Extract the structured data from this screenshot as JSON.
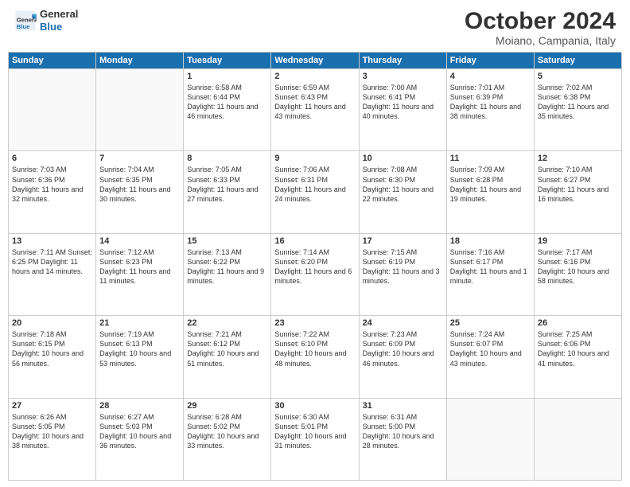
{
  "header": {
    "logo_line1": "General",
    "logo_line2": "Blue",
    "month": "October 2024",
    "location": "Moiano, Campania, Italy"
  },
  "days_of_week": [
    "Sunday",
    "Monday",
    "Tuesday",
    "Wednesday",
    "Thursday",
    "Friday",
    "Saturday"
  ],
  "weeks": [
    [
      {
        "day": "",
        "info": ""
      },
      {
        "day": "",
        "info": ""
      },
      {
        "day": "1",
        "info": "Sunrise: 6:58 AM\nSunset: 6:44 PM\nDaylight: 11 hours and 46 minutes."
      },
      {
        "day": "2",
        "info": "Sunrise: 6:59 AM\nSunset: 6:43 PM\nDaylight: 11 hours and 43 minutes."
      },
      {
        "day": "3",
        "info": "Sunrise: 7:00 AM\nSunset: 6:41 PM\nDaylight: 11 hours and 40 minutes."
      },
      {
        "day": "4",
        "info": "Sunrise: 7:01 AM\nSunset: 6:39 PM\nDaylight: 11 hours and 38 minutes."
      },
      {
        "day": "5",
        "info": "Sunrise: 7:02 AM\nSunset: 6:38 PM\nDaylight: 11 hours and 35 minutes."
      }
    ],
    [
      {
        "day": "6",
        "info": "Sunrise: 7:03 AM\nSunset: 6:36 PM\nDaylight: 11 hours and 32 minutes."
      },
      {
        "day": "7",
        "info": "Sunrise: 7:04 AM\nSunset: 6:35 PM\nDaylight: 11 hours and 30 minutes."
      },
      {
        "day": "8",
        "info": "Sunrise: 7:05 AM\nSunset: 6:33 PM\nDaylight: 11 hours and 27 minutes."
      },
      {
        "day": "9",
        "info": "Sunrise: 7:06 AM\nSunset: 6:31 PM\nDaylight: 11 hours and 24 minutes."
      },
      {
        "day": "10",
        "info": "Sunrise: 7:08 AM\nSunset: 6:30 PM\nDaylight: 11 hours and 22 minutes."
      },
      {
        "day": "11",
        "info": "Sunrise: 7:09 AM\nSunset: 6:28 PM\nDaylight: 11 hours and 19 minutes."
      },
      {
        "day": "12",
        "info": "Sunrise: 7:10 AM\nSunset: 6:27 PM\nDaylight: 11 hours and 16 minutes."
      }
    ],
    [
      {
        "day": "13",
        "info": "Sunrise: 7:11 AM\nSunset: 6:25 PM\nDaylight: 11 hours and 14 minutes."
      },
      {
        "day": "14",
        "info": "Sunrise: 7:12 AM\nSunset: 6:23 PM\nDaylight: 11 hours and 11 minutes."
      },
      {
        "day": "15",
        "info": "Sunrise: 7:13 AM\nSunset: 6:22 PM\nDaylight: 11 hours and 9 minutes."
      },
      {
        "day": "16",
        "info": "Sunrise: 7:14 AM\nSunset: 6:20 PM\nDaylight: 11 hours and 6 minutes."
      },
      {
        "day": "17",
        "info": "Sunrise: 7:15 AM\nSunset: 6:19 PM\nDaylight: 11 hours and 3 minutes."
      },
      {
        "day": "18",
        "info": "Sunrise: 7:16 AM\nSunset: 6:17 PM\nDaylight: 11 hours and 1 minute."
      },
      {
        "day": "19",
        "info": "Sunrise: 7:17 AM\nSunset: 6:16 PM\nDaylight: 10 hours and 58 minutes."
      }
    ],
    [
      {
        "day": "20",
        "info": "Sunrise: 7:18 AM\nSunset: 6:15 PM\nDaylight: 10 hours and 56 minutes."
      },
      {
        "day": "21",
        "info": "Sunrise: 7:19 AM\nSunset: 6:13 PM\nDaylight: 10 hours and 53 minutes."
      },
      {
        "day": "22",
        "info": "Sunrise: 7:21 AM\nSunset: 6:12 PM\nDaylight: 10 hours and 51 minutes."
      },
      {
        "day": "23",
        "info": "Sunrise: 7:22 AM\nSunset: 6:10 PM\nDaylight: 10 hours and 48 minutes."
      },
      {
        "day": "24",
        "info": "Sunrise: 7:23 AM\nSunset: 6:09 PM\nDaylight: 10 hours and 46 minutes."
      },
      {
        "day": "25",
        "info": "Sunrise: 7:24 AM\nSunset: 6:07 PM\nDaylight: 10 hours and 43 minutes."
      },
      {
        "day": "26",
        "info": "Sunrise: 7:25 AM\nSunset: 6:06 PM\nDaylight: 10 hours and 41 minutes."
      }
    ],
    [
      {
        "day": "27",
        "info": "Sunrise: 6:26 AM\nSunset: 5:05 PM\nDaylight: 10 hours and 38 minutes."
      },
      {
        "day": "28",
        "info": "Sunrise: 6:27 AM\nSunset: 5:03 PM\nDaylight: 10 hours and 36 minutes."
      },
      {
        "day": "29",
        "info": "Sunrise: 6:28 AM\nSunset: 5:02 PM\nDaylight: 10 hours and 33 minutes."
      },
      {
        "day": "30",
        "info": "Sunrise: 6:30 AM\nSunset: 5:01 PM\nDaylight: 10 hours and 31 minutes."
      },
      {
        "day": "31",
        "info": "Sunrise: 6:31 AM\nSunset: 5:00 PM\nDaylight: 10 hours and 28 minutes."
      },
      {
        "day": "",
        "info": ""
      },
      {
        "day": "",
        "info": ""
      }
    ]
  ]
}
